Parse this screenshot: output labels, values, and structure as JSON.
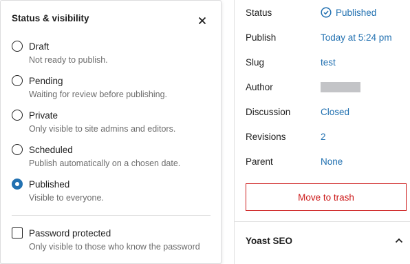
{
  "sidebar": {
    "rows": [
      {
        "label": "Status",
        "value": "Published"
      },
      {
        "label": "Publish",
        "value": "Today at 5:24 pm"
      },
      {
        "label": "Slug",
        "value": "test"
      },
      {
        "label": "Author",
        "value": ""
      },
      {
        "label": "Discussion",
        "value": "Closed"
      },
      {
        "label": "Revisions",
        "value": "2"
      },
      {
        "label": "Parent",
        "value": "None"
      }
    ],
    "trash_button": "Move to trash",
    "yoast_title": "Yoast SEO"
  },
  "popover": {
    "title": "Status & visibility",
    "options": [
      {
        "label": "Draft",
        "desc": "Not ready to publish.",
        "checked": false
      },
      {
        "label": "Pending",
        "desc": "Waiting for review before publishing.",
        "checked": false
      },
      {
        "label": "Private",
        "desc": "Only visible to site admins and editors.",
        "checked": false
      },
      {
        "label": "Scheduled",
        "desc": "Publish automatically on a chosen date.",
        "checked": false
      },
      {
        "label": "Published",
        "desc": "Visible to everyone.",
        "checked": true
      }
    ],
    "password": {
      "label": "Password protected",
      "desc": "Only visible to those who know the password",
      "checked": false
    }
  },
  "colors": {
    "link": "#2271b1",
    "danger": "#cc1818",
    "muted": "#6c6c6c"
  }
}
